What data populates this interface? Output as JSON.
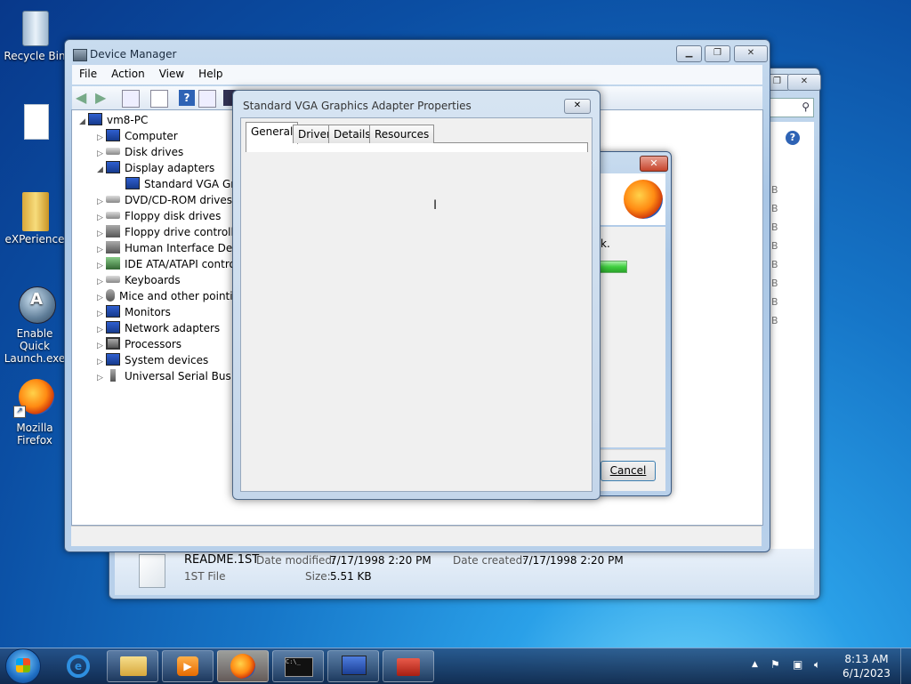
{
  "desktop": {
    "icons": [
      {
        "label": "Recycle Bin"
      },
      {
        "label": ""
      },
      {
        "label": "eXPerience"
      },
      {
        "label": "Enable Quick Launch.exe"
      },
      {
        "label": "Mozilla Firefox"
      }
    ]
  },
  "explorer_window": {
    "file_name": "README.1ST",
    "file_type": "1ST File",
    "date_modified_label": "Date modified:",
    "date_modified": "7/17/1998 2:20 PM",
    "date_created_label": "Date created:",
    "date_created": "7/17/1998 2:20 PM",
    "size_label": "Size:",
    "size": "5.51 KB",
    "size_column": [
      "B",
      "B",
      "B",
      "B",
      "B",
      "B",
      "B",
      "B"
    ]
  },
  "device_manager": {
    "title": "Device Manager",
    "menu": [
      "File",
      "Action",
      "View",
      "Help"
    ],
    "tree": {
      "root": "vm8-PC",
      "items": [
        {
          "label": "Computer",
          "expanded": false
        },
        {
          "label": "Disk drives",
          "expanded": false
        },
        {
          "label": "Display adapters",
          "expanded": true
        },
        {
          "label": "Standard VGA Grap",
          "child": true
        },
        {
          "label": "DVD/CD-ROM drives",
          "expanded": false
        },
        {
          "label": "Floppy disk drives",
          "expanded": false
        },
        {
          "label": "Floppy drive controller",
          "expanded": false
        },
        {
          "label": "Human Interface Devic",
          "expanded": false
        },
        {
          "label": "IDE ATA/ATAPI contro",
          "expanded": false
        },
        {
          "label": "Keyboards",
          "expanded": false
        },
        {
          "label": "Mice and other pointin",
          "expanded": false
        },
        {
          "label": "Monitors",
          "expanded": false
        },
        {
          "label": "Network adapters",
          "expanded": false
        },
        {
          "label": "Processors",
          "expanded": false
        },
        {
          "label": "System devices",
          "expanded": false
        },
        {
          "label": "Universal Serial Bus co",
          "expanded": false
        }
      ]
    }
  },
  "firefox_dialog": {
    "text_fragment": "k.",
    "cancel_label": "Cancel"
  },
  "properties_dialog": {
    "title": "Standard VGA Graphics Adapter Properties",
    "tabs": [
      "General",
      "Driver",
      "Details",
      "Resources"
    ],
    "active_tab": "General"
  },
  "taskbar": {
    "time": "8:13 AM",
    "date": "6/1/2023"
  },
  "colors": {
    "desktop_blue": "#1676c8",
    "progress_green": "#3fcf3f"
  }
}
